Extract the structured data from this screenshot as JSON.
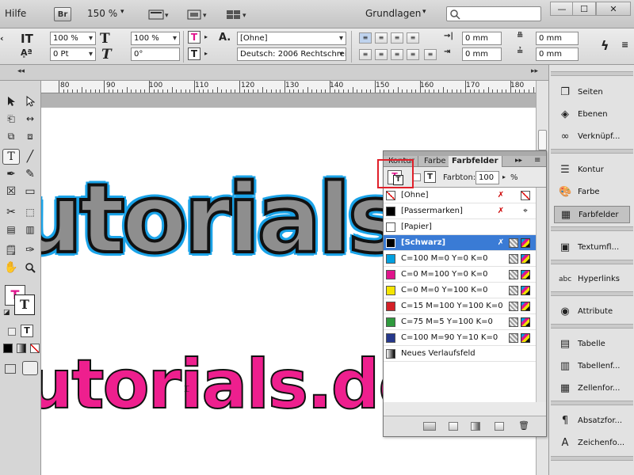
{
  "menubar": {
    "help": "Hilfe",
    "bridge": "Br",
    "zoom": "150 %",
    "workspace": "Grundlagen"
  },
  "control": {
    "scale_h": "100 %",
    "scale_v": "100 %",
    "tracking": "0 Pt",
    "skew": "0°",
    "char_style": "[Ohne]",
    "language": "Deutsch: 2006 Rechtschreib",
    "indent1": "0 mm",
    "indent2": "0 mm",
    "indent3": "0 mm",
    "indent4": "0 mm"
  },
  "ruler": {
    "labels": [
      "80",
      "90",
      "100",
      "110",
      "120",
      "130",
      "140",
      "150",
      "160",
      "170",
      "180"
    ]
  },
  "canvas": {
    "text_large": "utorials.d",
    "text_pink": "tutorials.de"
  },
  "swatches_panel": {
    "tabs": [
      "Kontur",
      "Farbe",
      "Farbfelder"
    ],
    "tint_label": "Farbton:",
    "tint_value": "100",
    "tint_unit": "%",
    "rows": [
      {
        "name": "[Ohne]",
        "color": "none"
      },
      {
        "name": "[Passermarken]",
        "color": "#000000"
      },
      {
        "name": "[Papier]",
        "color": "#ffffff"
      },
      {
        "name": "[Schwarz]",
        "color": "#000000"
      },
      {
        "name": "C=100 M=0 Y=0 K=0",
        "color": "#00a0e0"
      },
      {
        "name": "C=0 M=100 Y=0 K=0",
        "color": "#e0148c"
      },
      {
        "name": "C=0 M=0 Y=100 K=0",
        "color": "#f5e500"
      },
      {
        "name": "C=15 M=100 Y=100 K=0",
        "color": "#d42027"
      },
      {
        "name": "C=75 M=5 Y=100 K=0",
        "color": "#2f9a3e"
      },
      {
        "name": "C=100 M=90 Y=10 K=0",
        "color": "#26388c"
      },
      {
        "name": "Neues Verlaufsfeld",
        "color": "gradient"
      }
    ]
  },
  "dock": {
    "items": [
      "Seiten",
      "Ebenen",
      "Verknüpf...",
      "Kontur",
      "Farbe",
      "Farbfelder",
      "Textumfl...",
      "Hyperlinks",
      "Attribute",
      "Tabelle",
      "Tabellenf...",
      "Zellenfor...",
      "Absatzfor...",
      "Zeichenfo..."
    ]
  },
  "colors": {
    "highlight": "#e0202a",
    "selection": "#3a7bd5",
    "text_pink": "#ee1f8e",
    "text_outline_blue": "#1aa3e8"
  }
}
